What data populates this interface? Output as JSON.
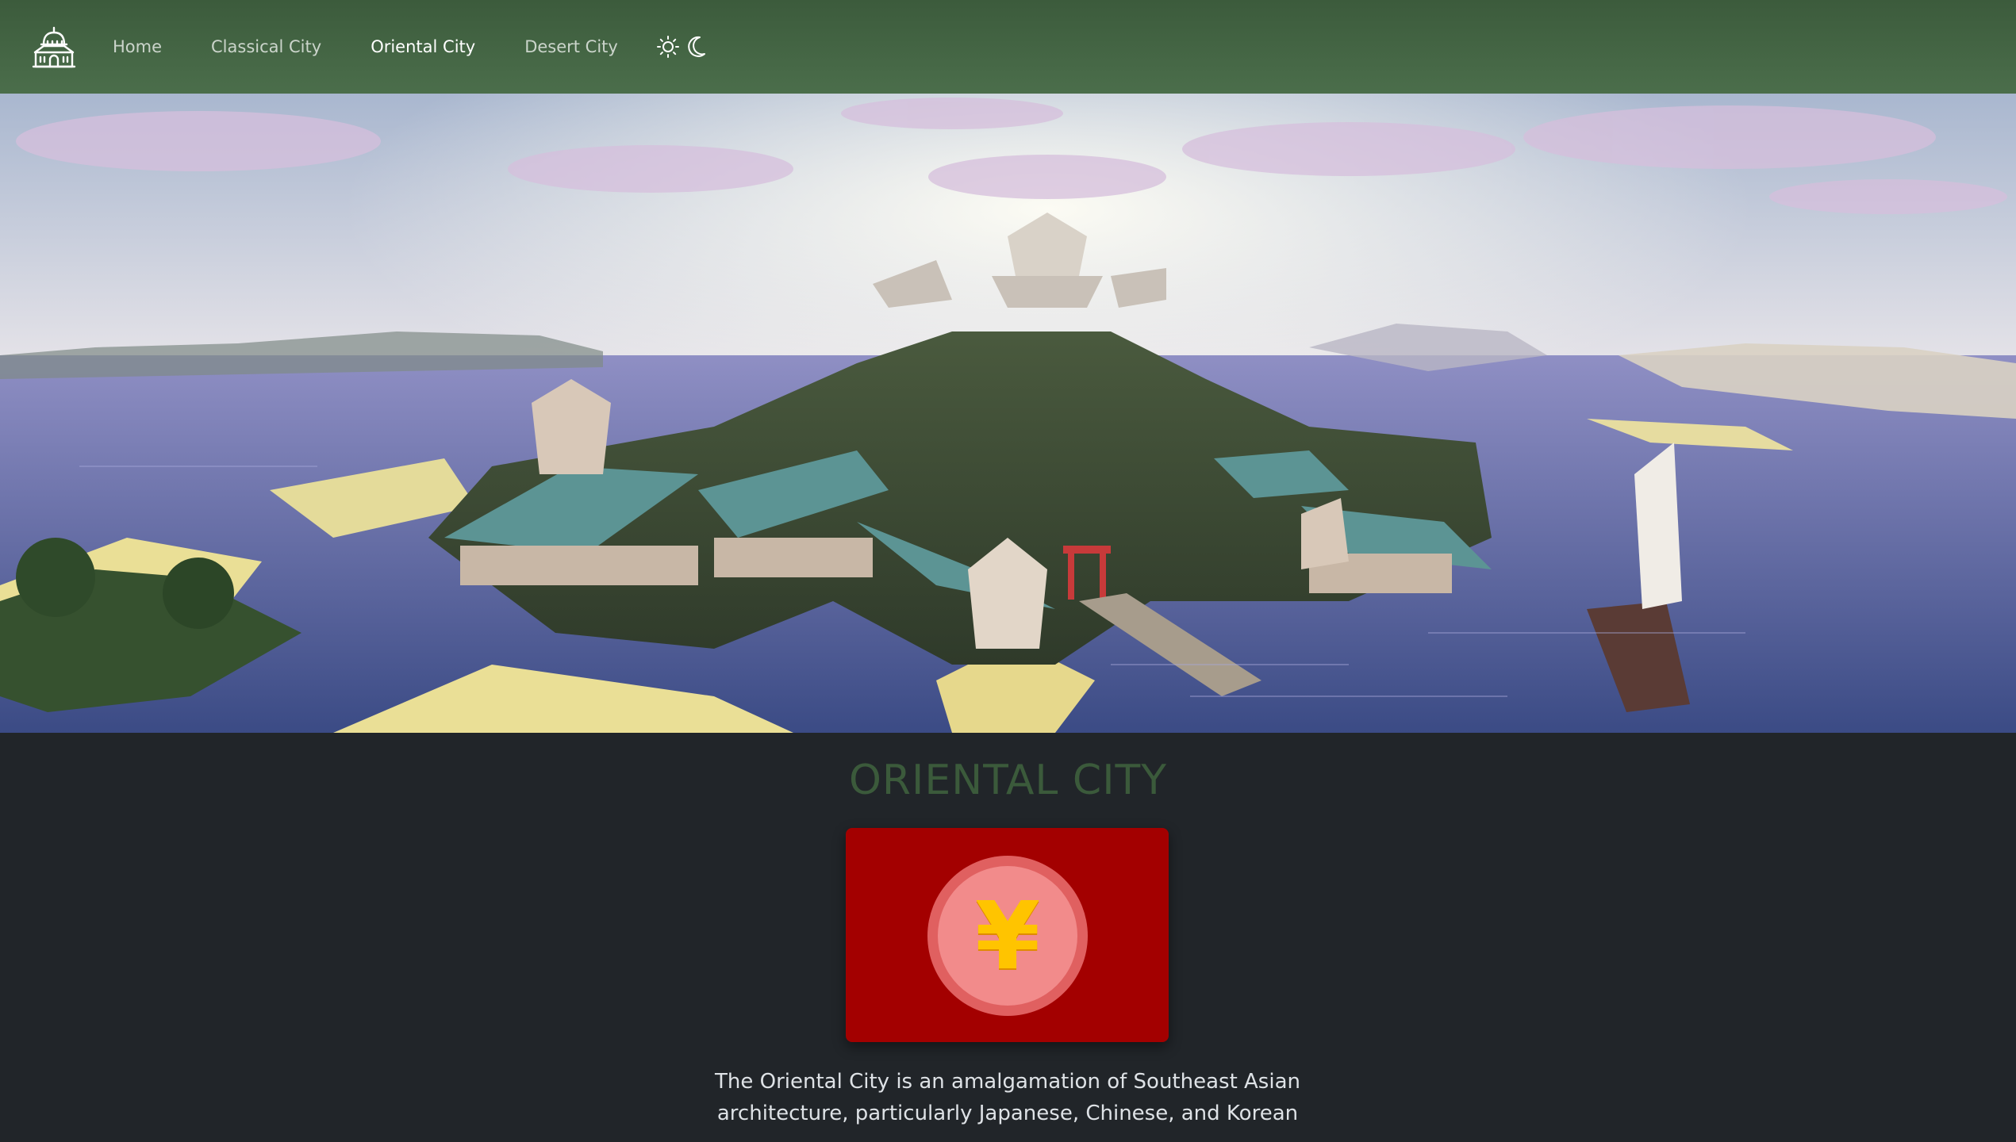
{
  "navbar": {
    "brand_icon": "palace-icon",
    "links": [
      {
        "label": "Home",
        "active": false
      },
      {
        "label": "Classical City",
        "active": false
      },
      {
        "label": "Oriental City",
        "active": true
      },
      {
        "label": "Desert City",
        "active": false
      }
    ],
    "theme_icons": [
      "sun-icon",
      "moon-icon"
    ],
    "background_color": "#3c5b3c"
  },
  "hero": {
    "image_subject": "voxel oriental castle city on an island in the sea"
  },
  "main": {
    "title": "ORIENTAL CITY",
    "emblem": {
      "symbol": "¥",
      "card_color": "#a30000",
      "coin_color": "#f28b8b",
      "symbol_color": "#ffc400"
    },
    "description": "The Oriental City is an amalgamation of Southeast Asian architecture, particularly Japanese, Chinese, and Korean"
  },
  "colors": {
    "page_background": "#212529",
    "title": "#3b5a3b",
    "text": "#dee2e6"
  }
}
